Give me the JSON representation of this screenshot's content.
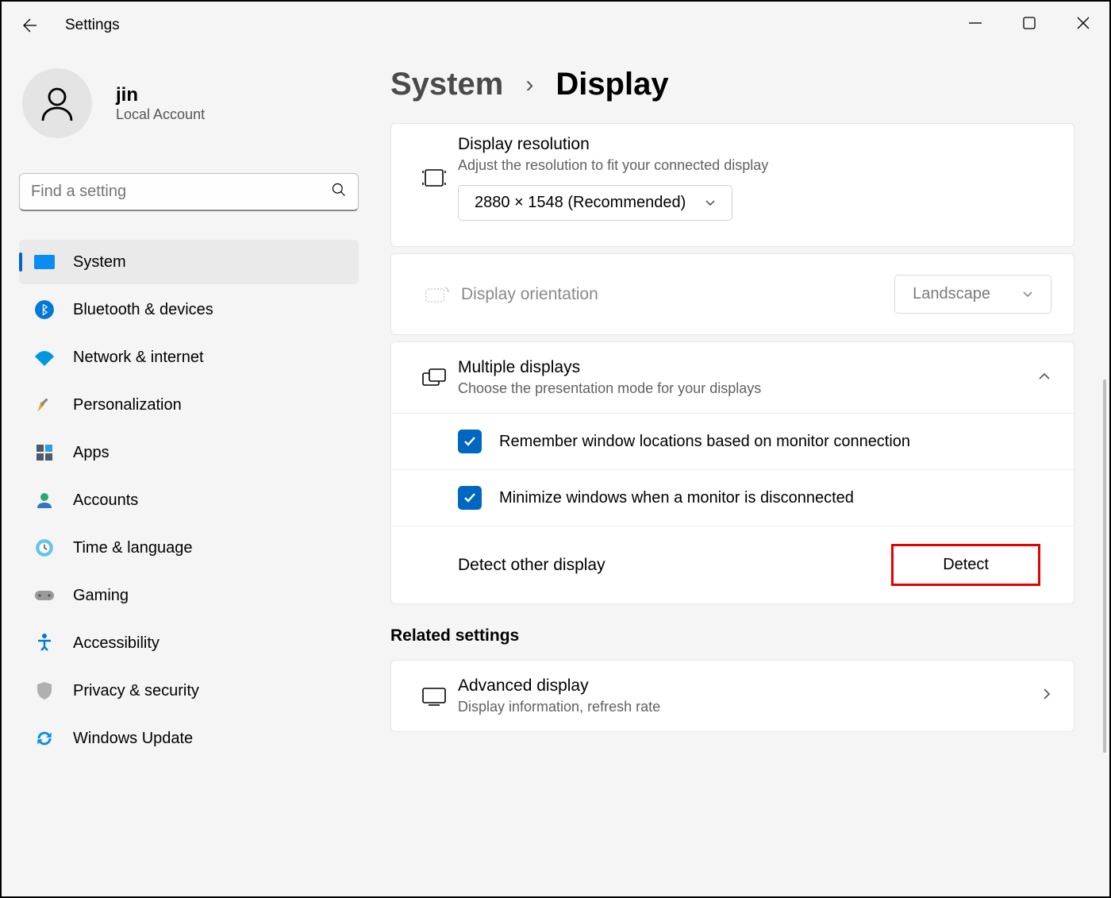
{
  "window": {
    "title": "Settings"
  },
  "user": {
    "name": "jin",
    "type": "Local Account"
  },
  "search": {
    "placeholder": "Find a setting"
  },
  "nav": [
    {
      "label": "System"
    },
    {
      "label": "Bluetooth & devices"
    },
    {
      "label": "Network & internet"
    },
    {
      "label": "Personalization"
    },
    {
      "label": "Apps"
    },
    {
      "label": "Accounts"
    },
    {
      "label": "Time & language"
    },
    {
      "label": "Gaming"
    },
    {
      "label": "Accessibility"
    },
    {
      "label": "Privacy & security"
    },
    {
      "label": "Windows Update"
    }
  ],
  "breadcrumb": {
    "parent": "System",
    "current": "Display"
  },
  "resolution": {
    "title": "Display resolution",
    "sub": "Adjust the resolution to fit your connected display",
    "value": "2880 × 1548 (Recommended)"
  },
  "orientation": {
    "title": "Display orientation",
    "value": "Landscape"
  },
  "multi": {
    "title": "Multiple displays",
    "sub": "Choose the presentation mode for your displays",
    "opt1": "Remember window locations based on monitor connection",
    "opt2": "Minimize windows when a monitor is disconnected",
    "detect_label": "Detect other display",
    "detect_btn": "Detect"
  },
  "related": {
    "heading": "Related settings",
    "adv_title": "Advanced display",
    "adv_sub": "Display information, refresh rate"
  }
}
